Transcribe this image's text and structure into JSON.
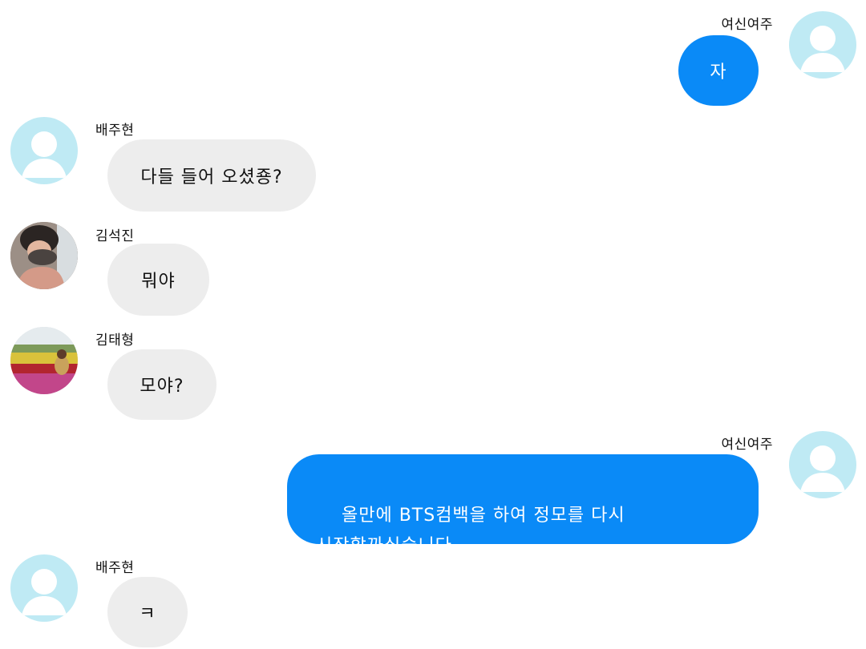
{
  "colors": {
    "sent_bubble": "#0a8af7",
    "received_bubble": "#ededed",
    "default_avatar": "#bfeaf4"
  },
  "messages": [
    {
      "sender": "여신여주",
      "text": "자",
      "side": "right",
      "avatar": "default-avatar-icon"
    },
    {
      "sender": "배주현",
      "text": "다들 들어 오셨죵?",
      "side": "left",
      "avatar": "default-avatar-icon"
    },
    {
      "sender": "김석진",
      "text": "뭐야",
      "side": "left",
      "avatar": "photo-avatar"
    },
    {
      "sender": "김태형",
      "text": "모야?",
      "side": "left",
      "avatar": "photo-avatar"
    },
    {
      "sender": "여신여주",
      "text": "올만에 BTS컴백을 하여 정모를 다시\n시작할까싶습니다.",
      "side": "right",
      "avatar": "default-avatar-icon"
    },
    {
      "sender": "배주현",
      "text": "ㅋ",
      "side": "left",
      "avatar": "default-avatar-icon"
    }
  ]
}
